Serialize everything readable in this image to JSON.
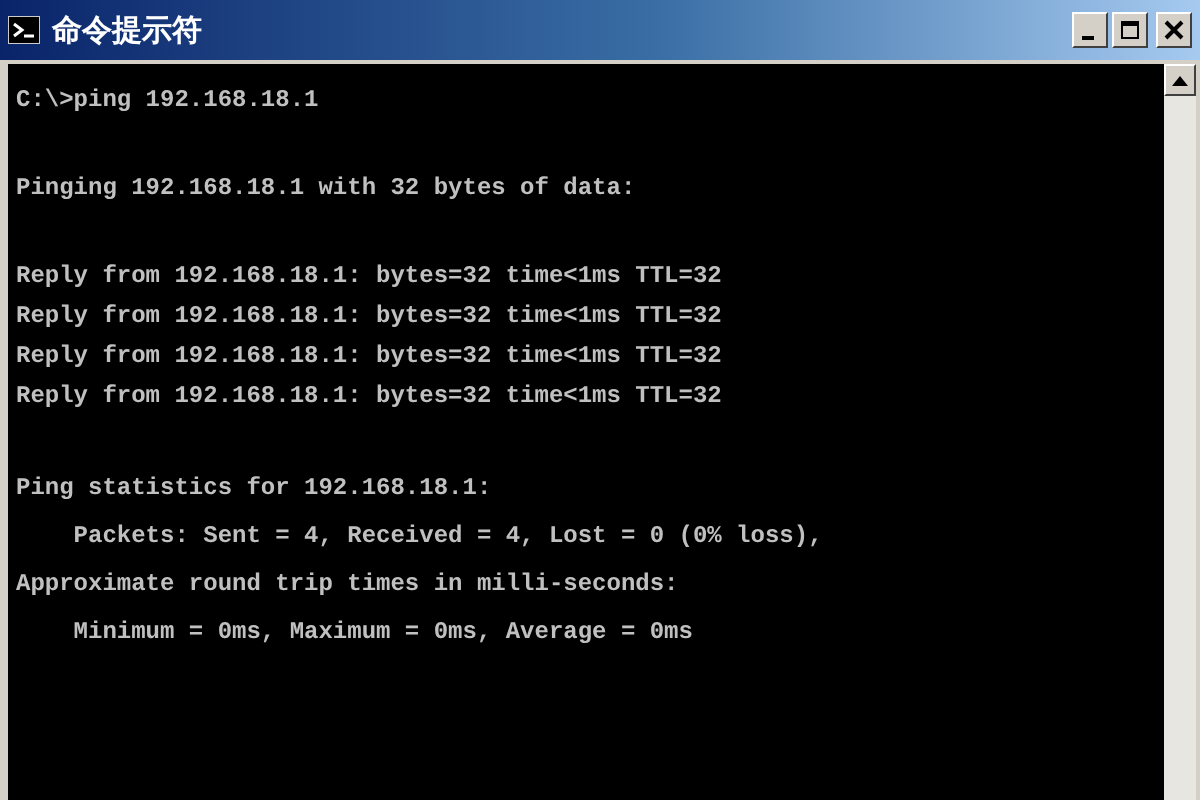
{
  "window": {
    "title": "命令提示符"
  },
  "console": {
    "groups": [
      [
        "C:\\>ping 192.168.18.1"
      ],
      [
        "Pinging 192.168.18.1 with 32 bytes of data:"
      ],
      [
        "Reply from 192.168.18.1: bytes=32 time<1ms TTL=32",
        "Reply from 192.168.18.1: bytes=32 time<1ms TTL=32",
        "Reply from 192.168.18.1: bytes=32 time<1ms TTL=32",
        "Reply from 192.168.18.1: bytes=32 time<1ms TTL=32"
      ],
      [
        "Ping statistics for 192.168.18.1:",
        "    Packets: Sent = 4, Received = 4, Lost = 0 (0% loss),",
        "Approximate round trip times in milli-seconds:",
        "    Minimum = 0ms, Maximum = 0ms, Average = 0ms"
      ]
    ]
  }
}
